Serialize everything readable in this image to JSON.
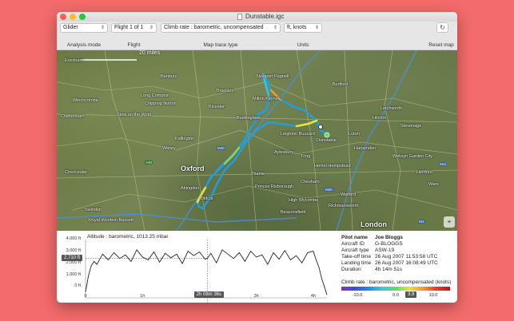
{
  "window": {
    "title": "Dunstable.igc"
  },
  "toolbar": {
    "analysis_mode": {
      "value": "Glider",
      "label": "Analysis mode"
    },
    "flight": {
      "value": "Flight 1 of 1",
      "label": "Flight"
    },
    "trace_type": {
      "value": "Climb rate : barometric, uncompensated",
      "label": "Map trace type"
    },
    "units": {
      "value": "ft, knots",
      "label": "Units"
    },
    "reset": {
      "label": "Reset map"
    }
  },
  "map": {
    "scale_label": "20 miles",
    "towns": [
      "Evesham",
      "Banbury",
      "Bicester",
      "Chipping Norton",
      "Long Compton",
      "Winchcombe",
      "Cheltenham",
      "Stow on the Wold",
      "Kidlington",
      "Witney",
      "Oxford",
      "Abingdon",
      "Didcot",
      "Cirencester",
      "Swindon",
      "Thame",
      "Aylesbury",
      "Princes Risborough",
      "High Wycombe",
      "Tring",
      "Luton",
      "Stevenage",
      "Hitchin",
      "Hemel Hempstead",
      "Watford",
      "Harpenden",
      "Welwyn Garden City",
      "Letchworth",
      "Milton Keynes",
      "Newport Pagnell",
      "Bedford",
      "Leighton Buzzard",
      "Dunstable",
      "Chesham",
      "Beaconsfield",
      "Rickmansworth",
      "London",
      "Royal Wootton Bassett",
      "Brackley",
      "Buckingham",
      "Hertford",
      "Ware"
    ],
    "road_shields": [
      "M40",
      "A40",
      "M11",
      "M25",
      "M4"
    ],
    "icons": [
      "compass-icon"
    ]
  },
  "altitude_chart": {
    "title": "Altitude : barometric, 1013.25 mbar",
    "y_ticks": [
      "4,000 ft",
      "3,000 ft",
      "2,000 ft",
      "1,000 ft",
      "0 ft"
    ],
    "x_ticks": [
      "0",
      "1h",
      "2h",
      "3h",
      "4h"
    ],
    "cursor_value": "2,710 ft",
    "cursor_time": "2h 08m 36s"
  },
  "chart_data": {
    "type": "line",
    "title": "Altitude : barometric, 1013.25 mbar",
    "xlabel": "",
    "ylabel": "",
    "xlim": [
      0,
      4.24
    ],
    "ylim": [
      0,
      4000
    ],
    "x_unit": "hours",
    "x": [
      0,
      0.05,
      0.1,
      0.15,
      0.2,
      0.3,
      0.4,
      0.5,
      0.6,
      0.7,
      0.8,
      0.9,
      1.0,
      1.1,
      1.2,
      1.3,
      1.4,
      1.5,
      1.6,
      1.7,
      1.8,
      1.9,
      2.0,
      2.1,
      2.14,
      2.2,
      2.3,
      2.4,
      2.5,
      2.6,
      2.7,
      2.8,
      2.9,
      3.0,
      3.1,
      3.2,
      3.3,
      3.4,
      3.5,
      3.6,
      3.7,
      3.8,
      3.9,
      4.0,
      4.05,
      4.1,
      4.15,
      4.2,
      4.24
    ],
    "y": [
      400,
      1500,
      2200,
      2500,
      2300,
      3000,
      2600,
      3100,
      2700,
      2950,
      2500,
      3300,
      2800,
      2600,
      3150,
      2450,
      3050,
      2750,
      3000,
      2350,
      3200,
      2900,
      3150,
      2650,
      2710,
      3050,
      2400,
      3300,
      3000,
      2700,
      3100,
      2500,
      3200,
      2800,
      2950,
      2300,
      3100,
      2650,
      3250,
      2600,
      2900,
      2400,
      3100,
      3200,
      2600,
      2100,
      1300,
      700,
      200
    ]
  },
  "pilot_info": {
    "rows": [
      {
        "key": "Pilot name",
        "value": "Joe Bloggs"
      },
      {
        "key": "Aircraft ID",
        "value": "G-BLOGGS"
      },
      {
        "key": "Aircraft type",
        "value": "ASW-19"
      },
      {
        "key": "Take-off time",
        "value": "26 Aug 2007 11:53:58 UTC"
      },
      {
        "key": "Landing time",
        "value": "26 Aug 2007 16:08:49 UTC"
      },
      {
        "key": "Duration",
        "value": "4h 14m 51s"
      }
    ]
  },
  "climb_legend": {
    "title": "Climb rate : barometric, uncompensated (knots)",
    "min": "-10.0",
    "mid": "0.0",
    "current": "3.9",
    "max": "10.0",
    "colors": {
      "marker": "#555555"
    }
  }
}
